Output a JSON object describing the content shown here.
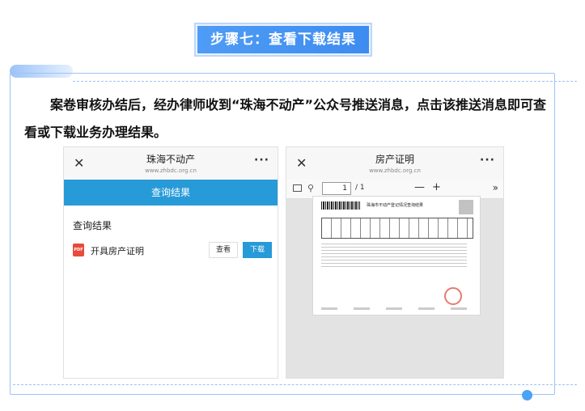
{
  "step_banner": "步骤七：查看下载结果",
  "description": "案卷审核办结后，经办律师收到“珠海不动产”公众号推送消息，点击该推送消息即可查看或下载业务办理结果。",
  "left_phone": {
    "close_glyph": "✕",
    "more_glyph": "···",
    "title": "珠海不动产",
    "url": "www.zhbdc.org.cn",
    "query_bar": "查询结果",
    "result_heading": "查询结果",
    "pdf_badge": "PDF",
    "result_item": "开具房产证明",
    "view_button": "查看",
    "download_button": "下载"
  },
  "right_phone": {
    "close_glyph": "✕",
    "more_glyph": "···",
    "title": "房产证明",
    "url": "www.zhbdc.org.cn",
    "search_glyph": "⚲",
    "page_current": "1",
    "page_total": "/ 1",
    "zoom_out": "—",
    "zoom_in": "+",
    "next_glyph": "»",
    "doc_title": "珠海市不动产登记情况查询结果"
  },
  "colors": {
    "accent_blue": "#279ad8",
    "banner_blue": "#4f9cf6",
    "frame_border": "#9cc3f7"
  },
  "icons": [
    "close-icon",
    "more-icon",
    "pdf-icon",
    "sidebar-toggle-icon",
    "search-icon",
    "zoom-out-icon",
    "zoom-in-icon",
    "next-page-icon"
  ]
}
